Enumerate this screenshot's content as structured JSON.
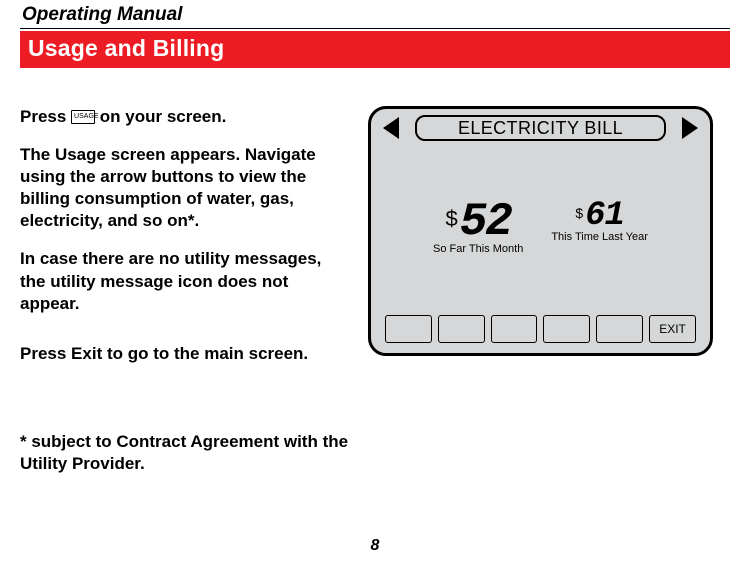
{
  "header": {
    "manual": "Operating Manual"
  },
  "section": {
    "title": "Usage and Billing"
  },
  "body": {
    "p1a": "Press ",
    "usage_btn": "USAGE",
    "p1b": " on your screen.",
    "p2": "The Usage screen appears. Navigate using the arrow buttons to view the billing consumption of water, gas, electricity, and so on*.",
    "p3": "In case there are no utility messages, the utility message icon does not appear.",
    "p4a": "Press ",
    "p4b": "Exit",
    "p4c": " to go to the main screen.",
    "foot": "* subject to Contract Agreement with the Utility Provider."
  },
  "device": {
    "title": "ELECTRICITY BILL",
    "current": {
      "currency": "$",
      "value": "52",
      "caption": "So Far This Month"
    },
    "previous": {
      "currency": "$",
      "value": "61",
      "caption": "This Time Last Year"
    },
    "buttons": [
      "",
      "",
      "",
      "",
      "",
      "EXIT"
    ]
  },
  "page": {
    "number": "8"
  }
}
